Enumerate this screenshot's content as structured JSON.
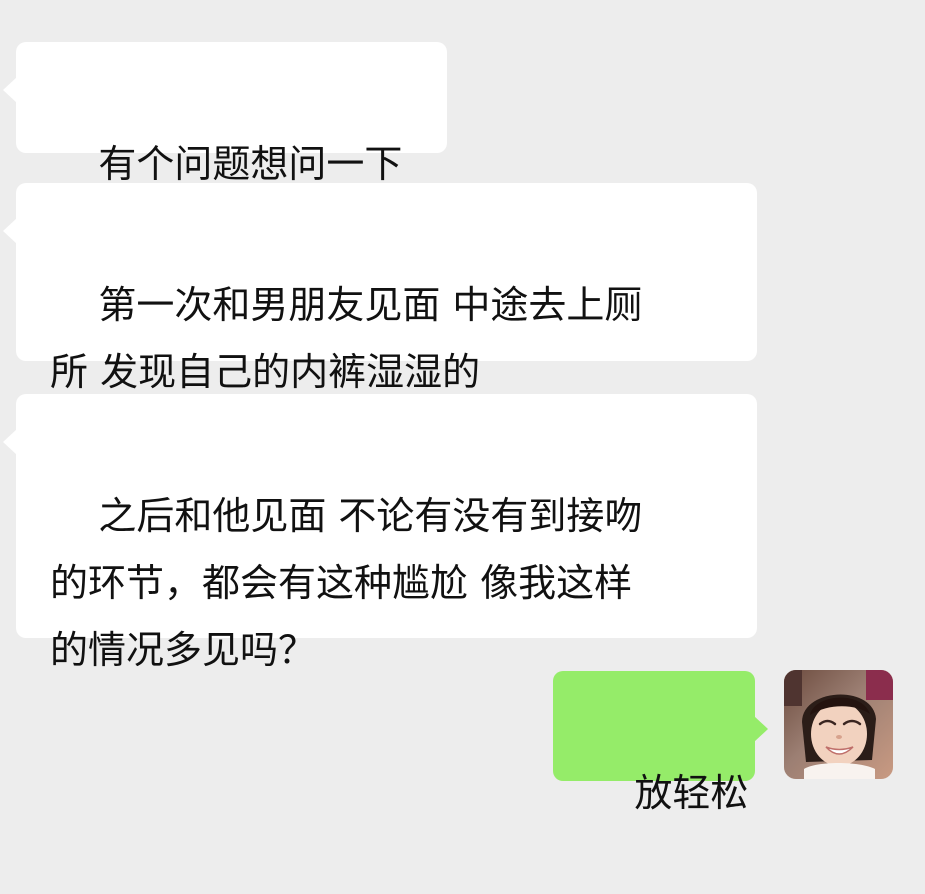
{
  "chat": {
    "messages": [
      {
        "sender": "other",
        "text": "有个问题想问一下"
      },
      {
        "sender": "other",
        "text": "第一次和男朋友见面 中途去上厕\n所 发现自己的内裤湿湿的"
      },
      {
        "sender": "other",
        "text": "之后和他见面 不论有没有到接吻\n的环节，都会有这种尴尬 像我这样\n的情况多见吗？"
      },
      {
        "sender": "me",
        "text": "放轻松"
      }
    ]
  },
  "colors": {
    "background": "#ededed",
    "incoming_bubble": "#ffffff",
    "outgoing_bubble": "#95ec69",
    "text": "#111111"
  },
  "icons": {
    "self_avatar": "child-portrait-avatar"
  }
}
